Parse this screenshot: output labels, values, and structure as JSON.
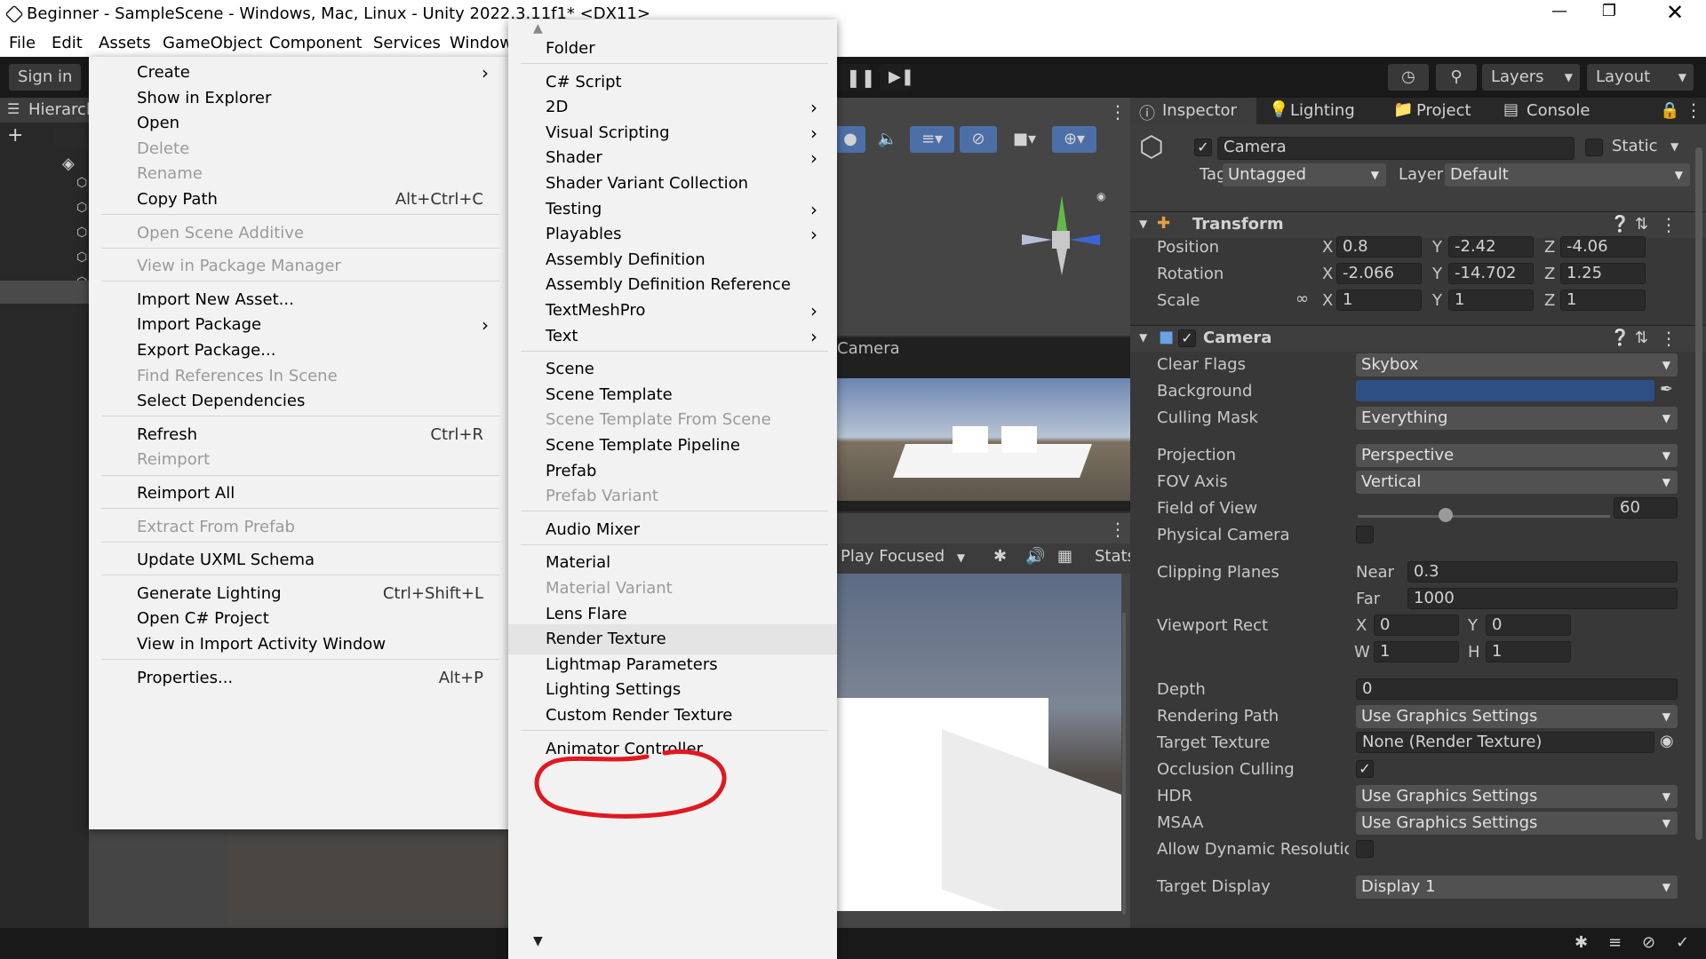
{
  "window": {
    "title": "Beginner - SampleScene - Windows, Mac, Linux - Unity 2022.3.11f1* <DX11>"
  },
  "menubar": [
    "File",
    "Edit",
    "Assets",
    "GameObject",
    "Component",
    "Services",
    "Window"
  ],
  "toolbar": {
    "sign_in": "Sign in",
    "layers": "Layers",
    "layout": "Layout"
  },
  "hierarchy": {
    "tab": "Hierarchy"
  },
  "assets_menu": [
    {
      "label": "Create",
      "arrow": "›"
    },
    {
      "label": "Show in Explorer"
    },
    {
      "label": "Open"
    },
    {
      "label": "Delete",
      "disabled": true
    },
    {
      "label": "Rename",
      "disabled": true
    },
    {
      "label": "Copy Path",
      "shortcut": "Alt+Ctrl+C"
    },
    {
      "label": "Open Scene Additive",
      "disabled": true
    },
    {
      "label": "View in Package Manager",
      "disabled": true
    },
    {
      "label": "Import New Asset..."
    },
    {
      "label": "Import Package",
      "arrow": "›"
    },
    {
      "label": "Export Package..."
    },
    {
      "label": "Find References In Scene",
      "disabled": true
    },
    {
      "label": "Select Dependencies"
    },
    {
      "label": "Refresh",
      "shortcut": "Ctrl+R"
    },
    {
      "label": "Reimport",
      "disabled": true
    },
    {
      "label": "Reimport All"
    },
    {
      "label": "Extract From Prefab",
      "disabled": true
    },
    {
      "label": "Update UXML Schema"
    },
    {
      "label": "Generate Lighting",
      "shortcut": "Ctrl+Shift+L"
    },
    {
      "label": "Open C# Project"
    },
    {
      "label": "View in Import Activity Window"
    },
    {
      "label": "Properties...",
      "shortcut": "Alt+P"
    }
  ],
  "create_menu": [
    {
      "label": "Folder"
    },
    {
      "label": "C# Script"
    },
    {
      "label": "2D",
      "arrow": "›"
    },
    {
      "label": "Visual Scripting",
      "arrow": "›"
    },
    {
      "label": "Shader",
      "arrow": "›"
    },
    {
      "label": "Shader Variant Collection"
    },
    {
      "label": "Testing",
      "arrow": "›"
    },
    {
      "label": "Playables",
      "arrow": "›"
    },
    {
      "label": "Assembly Definition"
    },
    {
      "label": "Assembly Definition Reference"
    },
    {
      "label": "TextMeshPro",
      "arrow": "›"
    },
    {
      "label": "Text",
      "arrow": "›"
    },
    {
      "label": "Scene"
    },
    {
      "label": "Scene Template"
    },
    {
      "label": "Scene Template From Scene",
      "disabled": true
    },
    {
      "label": "Scene Template Pipeline"
    },
    {
      "label": "Prefab"
    },
    {
      "label": "Prefab Variant",
      "disabled": true
    },
    {
      "label": "Audio Mixer"
    },
    {
      "label": "Material"
    },
    {
      "label": "Material Variant",
      "disabled": true
    },
    {
      "label": "Lens Flare"
    },
    {
      "label": "Render Texture",
      "highlighted": true
    },
    {
      "label": "Lightmap Parameters"
    },
    {
      "label": "Lighting Settings"
    },
    {
      "label": "Custom Render Texture"
    },
    {
      "label": "Animator Controller"
    }
  ],
  "scene": {
    "camera_preview_label": "Camera",
    "game_play_mode": "Play Focused",
    "stats": "Stats"
  },
  "inspector": {
    "tabs": [
      "Inspector",
      "Lighting",
      "Project",
      "Console"
    ],
    "object_name": "Camera",
    "static_label": "Static",
    "tag_label": "Tag",
    "tag_value": "Untagged",
    "layer_label": "Layer",
    "layer_value": "Default",
    "transform": {
      "title": "Transform",
      "position": {
        "label": "Position",
        "x": "0.8",
        "y": "-2.42",
        "z": "-4.06"
      },
      "rotation": {
        "label": "Rotation",
        "x": "-2.066",
        "y": "-14.702",
        "z": "1.25"
      },
      "scale": {
        "label": "Scale",
        "x": "1",
        "y": "1",
        "z": "1"
      }
    },
    "camera": {
      "title": "Camera",
      "clear_flags": {
        "label": "Clear Flags",
        "value": "Skybox"
      },
      "background": {
        "label": "Background",
        "color": "#2e4f86"
      },
      "culling_mask": {
        "label": "Culling Mask",
        "value": "Everything"
      },
      "projection": {
        "label": "Projection",
        "value": "Perspective"
      },
      "fov_axis": {
        "label": "FOV Axis",
        "value": "Vertical"
      },
      "field_of_view": {
        "label": "Field of View",
        "value": "60",
        "fraction": 0.35
      },
      "physical_camera": {
        "label": "Physical Camera"
      },
      "clipping_planes": {
        "label": "Clipping Planes",
        "near_label": "Near",
        "near": "0.3",
        "far_label": "Far",
        "far": "1000"
      },
      "viewport_rect": {
        "label": "Viewport Rect",
        "x": "0",
        "y": "0",
        "w": "1",
        "h": "1"
      },
      "depth": {
        "label": "Depth",
        "value": "0"
      },
      "rendering_path": {
        "label": "Rendering Path",
        "value": "Use Graphics Settings"
      },
      "target_texture": {
        "label": "Target Texture",
        "value": "None (Render Texture)"
      },
      "occlusion_culling": {
        "label": "Occlusion Culling"
      },
      "hdr": {
        "label": "HDR",
        "value": "Use Graphics Settings"
      },
      "msaa": {
        "label": "MSAA",
        "value": "Use Graphics Settings"
      },
      "allow_dynamic": {
        "label": "Allow Dynamic Resolution"
      },
      "target_display": {
        "label": "Target Display",
        "value": "Display 1"
      }
    }
  },
  "axes": {
    "x": "X",
    "y": "Y",
    "z": "Z",
    "w": "W",
    "h": "H"
  },
  "icons": [
    "unity-logo-icon",
    "minimize-icon",
    "maximize-icon",
    "close-icon",
    "pause-icon",
    "step-icon",
    "history-icon",
    "search-icon",
    "lock-icon",
    "more-icon",
    "help-icon",
    "preset-icon",
    "gear-icon",
    "eyedropper-icon",
    "target-icon",
    "cube-icon",
    "audio-mute-icon",
    "bug-icon",
    "grid-icon"
  ],
  "colors": {
    "accent_red": "#e0181f",
    "highlight": "#e4e4e4"
  }
}
